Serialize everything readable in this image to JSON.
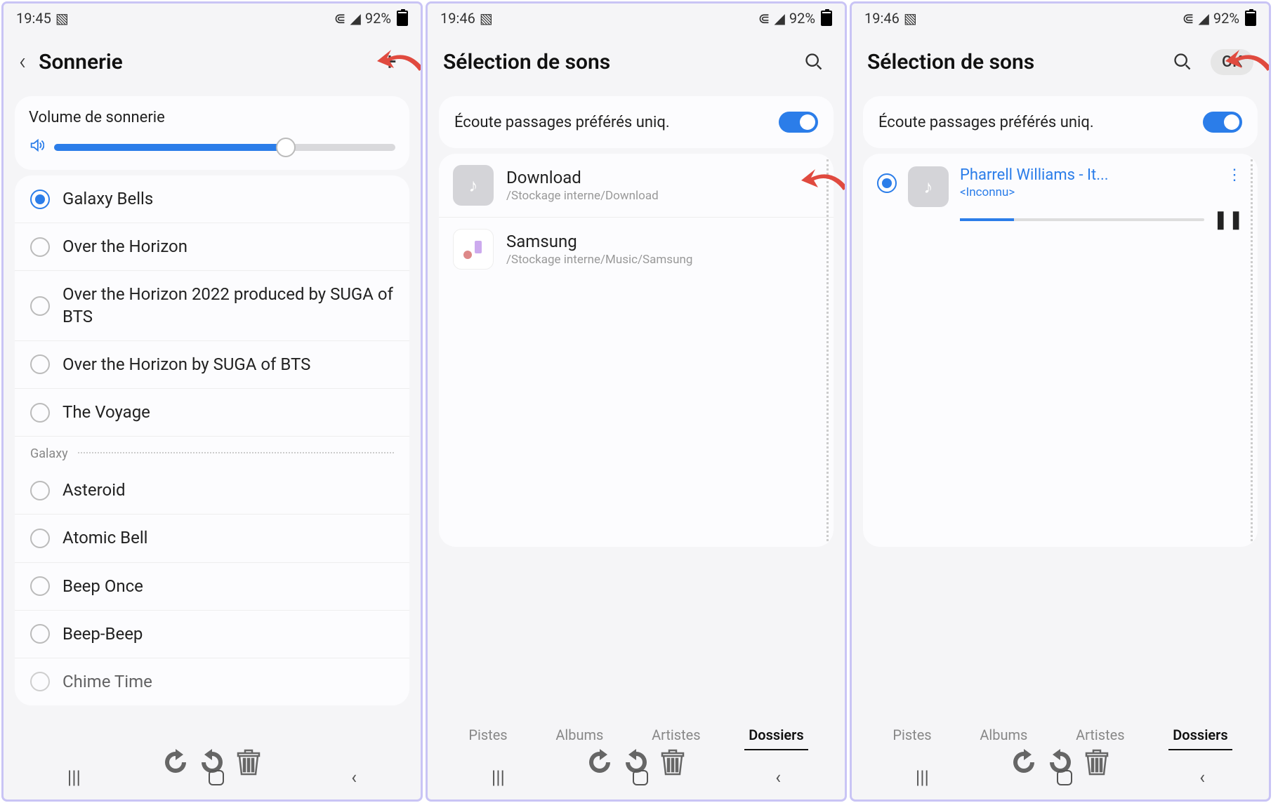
{
  "status": {
    "time1": "19:45",
    "time2": "19:46",
    "battery": "92%"
  },
  "screen1": {
    "title": "Sonnerie",
    "volume_label": "Volume de sonnerie",
    "ringtones": [
      {
        "label": "Galaxy Bells",
        "selected": true
      },
      {
        "label": "Over the Horizon",
        "selected": false
      },
      {
        "label": "Over the Horizon 2022 produced by SUGA of BTS",
        "selected": false
      },
      {
        "label": "Over the Horizon by SUGA of BTS",
        "selected": false
      },
      {
        "label": "The Voyage",
        "selected": false
      }
    ],
    "section_header": "Galaxy",
    "galaxy_ringtones": [
      {
        "label": "Asteroid"
      },
      {
        "label": "Atomic Bell"
      },
      {
        "label": "Beep Once"
      },
      {
        "label": "Beep-Beep"
      },
      {
        "label": "Chime Time"
      }
    ]
  },
  "screen2": {
    "title": "Sélection de sons",
    "toggle_label": "Écoute passages préférés uniq.",
    "folders": [
      {
        "name": "Download",
        "path": "/Stockage interne/Download"
      },
      {
        "name": "Samsung",
        "path": "/Stockage interne/Music/Samsung"
      }
    ]
  },
  "screen3": {
    "title": "Sélection de sons",
    "ok_label": "OK",
    "toggle_label": "Écoute passages préférés uniq.",
    "track": {
      "title": "Pharrell Williams - It...",
      "artist": "<Inconnu>"
    }
  },
  "tabs": {
    "pistes": "Pistes",
    "albums": "Albums",
    "artistes": "Artistes",
    "dossiers": "Dossiers"
  }
}
